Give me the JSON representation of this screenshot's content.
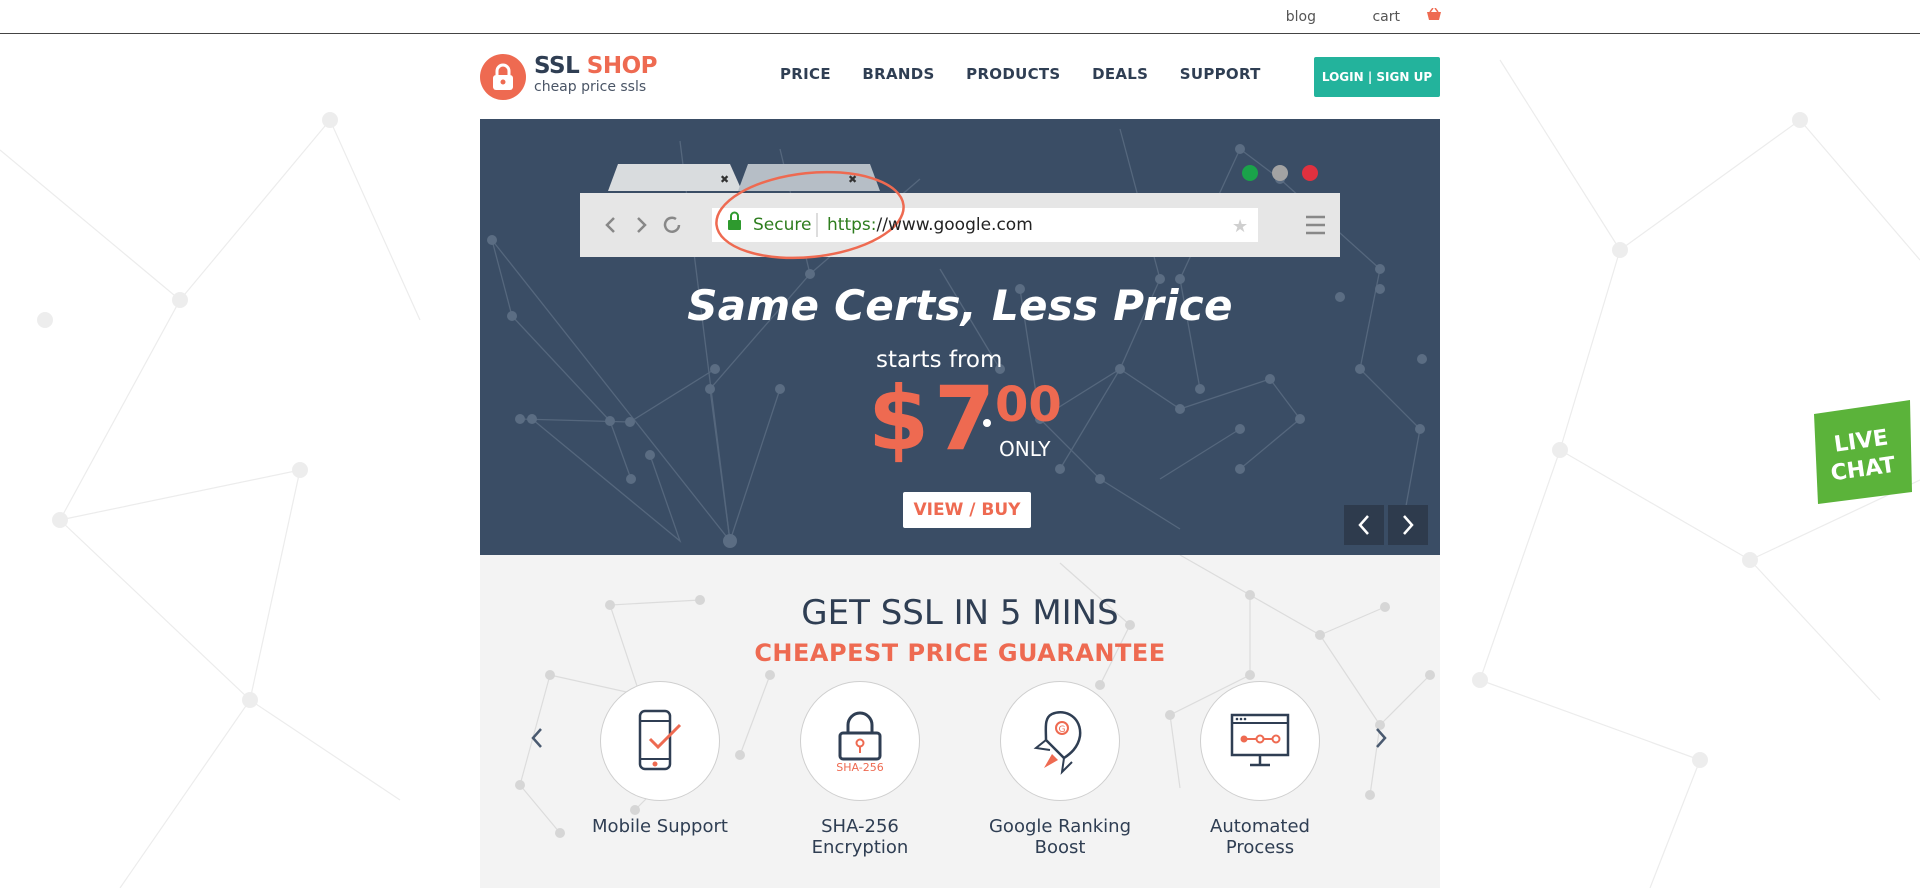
{
  "topbar": {
    "blog": "blog",
    "cart": "cart"
  },
  "logo": {
    "ssl": "SSL",
    "shop": "SHOP",
    "tagline": "cheap price ssls"
  },
  "nav": [
    "PRICE",
    "BRANDS",
    "PRODUCTS",
    "DEALS",
    "SUPPORT"
  ],
  "login_button": "LOGIN | SIGN UP",
  "browser": {
    "secure": "Secure",
    "https": "https:",
    "url_rest": "//www.google.com"
  },
  "hero": {
    "title": "Same Certs, Less Price",
    "starts_from": "starts from",
    "currency": "$",
    "price_whole": "7",
    "price_cents": "00",
    "only": "ONLY",
    "cta": "VIEW / BUY"
  },
  "section2": {
    "title": "GET SSL IN 5 MINS",
    "subtitle": "CHEAPEST PRICE GUARANTEE",
    "sha_badge": "SHA-256",
    "features": [
      {
        "label": "Mobile Support",
        "icon": "mobile-check-icon"
      },
      {
        "label": "SHA-256 Encryption",
        "icon": "lock-icon"
      },
      {
        "label": "Google Ranking Boost",
        "icon": "rocket-icon"
      },
      {
        "label": "Automated Process",
        "icon": "monitor-process-icon"
      }
    ]
  },
  "livechat": {
    "line1": "LIVE",
    "line2": "CHAT"
  },
  "colors": {
    "accent": "#ee6a51",
    "navy": "#2f3e53",
    "hero_bg": "#3a4d65",
    "teal": "#23b39c",
    "green": "#5bb33a"
  }
}
